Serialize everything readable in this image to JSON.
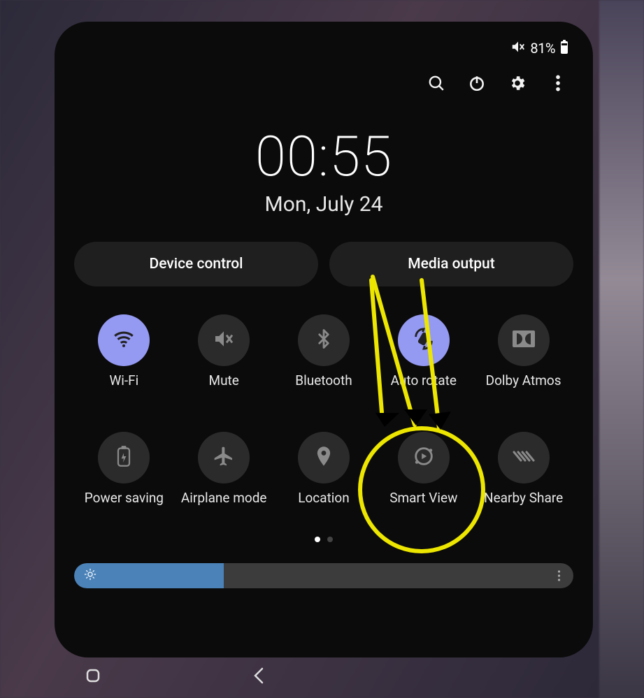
{
  "status": {
    "battery_percent": "81%",
    "muted": true
  },
  "toolbar_icons": [
    "search",
    "power",
    "settings",
    "more"
  ],
  "clock": {
    "time": "00:55",
    "date": "Mon, July 24"
  },
  "pills": {
    "device_control": "Device control",
    "media_output": "Media output"
  },
  "tiles": [
    {
      "id": "wifi",
      "label": "Wi-Fi",
      "active": true
    },
    {
      "id": "mute",
      "label": "Mute",
      "active": false
    },
    {
      "id": "bluetooth",
      "label": "Bluetooth",
      "active": false
    },
    {
      "id": "autorotate",
      "label": "Auto rotate",
      "active": true
    },
    {
      "id": "dolby",
      "label": "Dolby Atmos",
      "active": false
    },
    {
      "id": "powersaving",
      "label": "Power saving",
      "active": false
    },
    {
      "id": "airplane",
      "label": "Airplane mode",
      "active": false
    },
    {
      "id": "location",
      "label": "Location",
      "active": false
    },
    {
      "id": "smartview",
      "label": "Smart View",
      "active": false
    },
    {
      "id": "nearbyshare",
      "label": "Nearby Share",
      "active": false
    }
  ],
  "pagination": {
    "current": 0,
    "total": 2
  },
  "brightness": {
    "value": 30
  },
  "annotation": {
    "target": "smartview",
    "shape": "circle-with-arrow",
    "color": "#ede600"
  }
}
